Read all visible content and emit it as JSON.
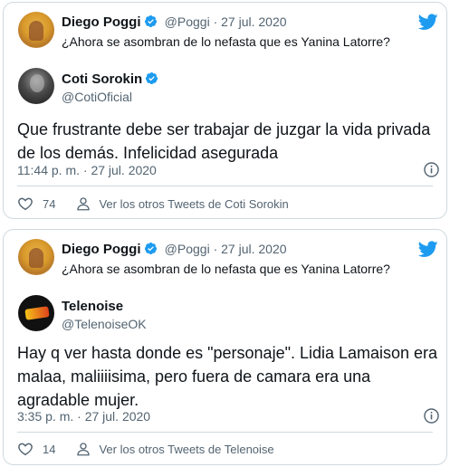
{
  "tweets": [
    {
      "quoted_name": "Diego Poggi",
      "quoted_meta": "@Poggi · 27 jul. 2020",
      "quoted_text": "¿Ahora se asombran de lo nefasta que es Yanina Latorre?",
      "author_name": "Coti Sorokin",
      "author_handle": "@CotiOficial",
      "author_verified": true,
      "text": "Que frustrante debe ser trabajar de juzgar la vida privada de los demás. Infelicidad asegurada",
      "time": "11:44 p. m. · 27 jul. 2020",
      "likes": "74",
      "more_link": "Ver los otros Tweets de Coti Sorokin"
    },
    {
      "quoted_name": "Diego Poggi",
      "quoted_meta": "@Poggi · 27 jul. 2020",
      "quoted_text": "¿Ahora se asombran de lo nefasta que es Yanina Latorre?",
      "author_name": "Telenoise",
      "author_handle": "@TelenoiseOK",
      "author_verified": false,
      "text": "Hay q ver hasta donde es \"personaje\". Lidia Lamaison era malaa, maliiiisima, pero fuera de camara era una agradable mujer.",
      "time": "3:35 p. m. · 27 jul. 2020",
      "likes": "14",
      "more_link": "Ver los otros Tweets de Telenoise"
    }
  ],
  "colors": {
    "twitter_blue": "#1d9bf0",
    "secondary_text": "#536471",
    "border": "#cfd9de",
    "heart_icon": "heart-outline-icon"
  }
}
